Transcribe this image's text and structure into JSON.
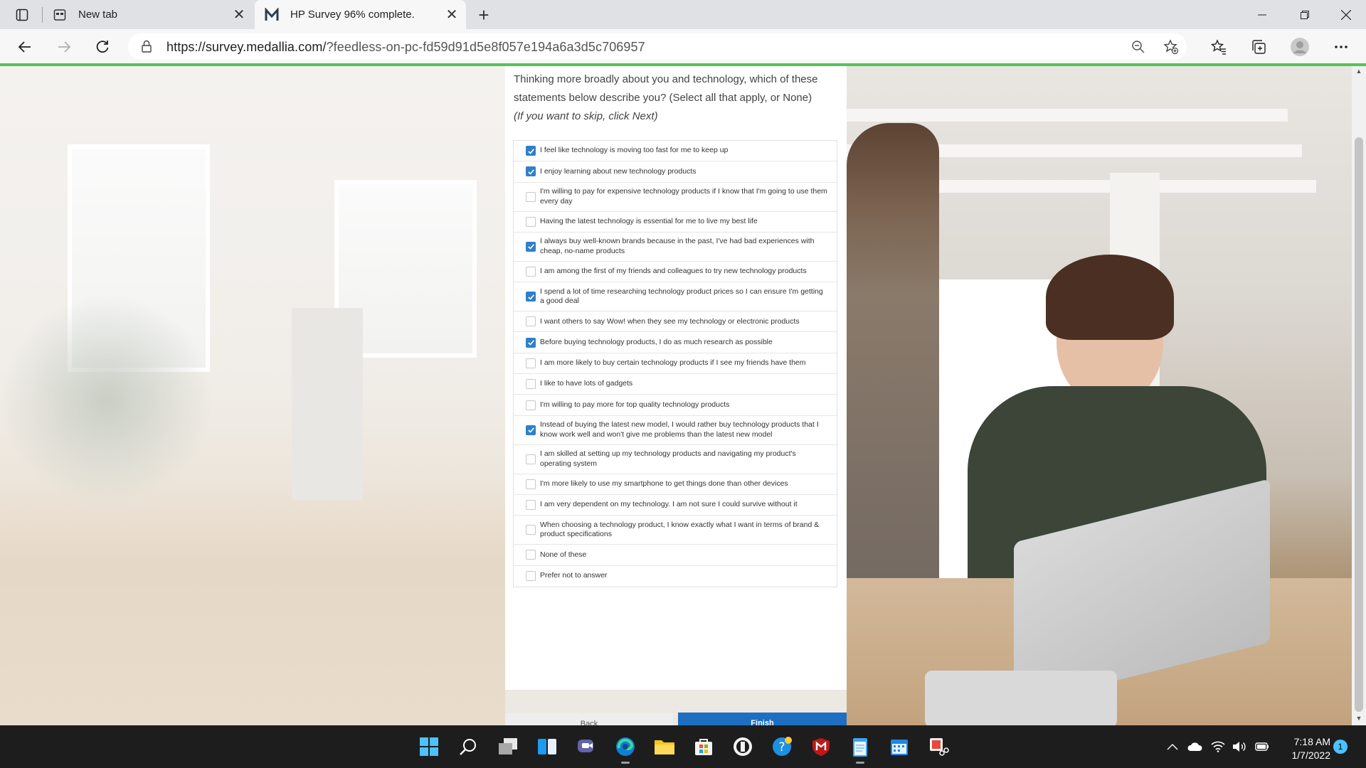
{
  "browser": {
    "tabs": [
      {
        "title": "New tab",
        "active": false,
        "icon": "new-tab-page-icon"
      },
      {
        "title": "HP Survey 96% complete.",
        "active": true,
        "icon": "medallia-m-icon"
      }
    ],
    "url_host": "https://survey.medallia.com/",
    "url_rest": "?feedless-on-pc-fd59d91d5e8f057e194a6a3d5c706957",
    "page_load_progress": 1.0,
    "accent_color": "#58c05a"
  },
  "survey": {
    "question": "Thinking more broadly about you and technology, which of these statements below describe you? (Select all that apply, or None)",
    "note": "(If you want to skip, click Next)",
    "options": [
      {
        "label": "I feel like technology is moving too fast for me to keep up",
        "checked": true
      },
      {
        "label": "I enjoy learning about new technology products",
        "checked": true
      },
      {
        "label": "I'm willing to pay for expensive technology products if I know that I'm going to use them every day",
        "checked": false
      },
      {
        "label": "Having the latest technology is essential for me to live my best life",
        "checked": false
      },
      {
        "label": "I always buy well-known brands because in the past, I've had bad experiences with cheap, no-name products",
        "checked": true
      },
      {
        "label": "I am among the first of my friends and colleagues to try new technology products",
        "checked": false
      },
      {
        "label": "I spend a lot of time researching technology product prices so I can ensure I'm getting a good deal",
        "checked": true
      },
      {
        "label": "I want others to say Wow! when they see my technology or electronic products",
        "checked": false
      },
      {
        "label": "Before buying technology products, I do as much research as possible",
        "checked": true
      },
      {
        "label": "I am more likely to buy certain technology products if I see my friends have them",
        "checked": false
      },
      {
        "label": "I like to have lots of gadgets",
        "checked": false
      },
      {
        "label": "I'm willing to pay more for top quality technology products",
        "checked": false
      },
      {
        "label": "Instead of buying the latest new model, I would rather buy technology products that I know work well and won't give me problems than the latest new model",
        "checked": true
      },
      {
        "label": "I am skilled at setting up my technology products and navigating my product's operating system",
        "checked": false
      },
      {
        "label": "I'm more likely to use my smartphone to get things done than other devices",
        "checked": false
      },
      {
        "label": "I am very dependent on my technology. I am not sure I could survive without it",
        "checked": false
      },
      {
        "label": "When choosing a technology product, I know exactly what I want in terms of brand & product specifications",
        "checked": false
      },
      {
        "label": "None of these",
        "checked": false
      },
      {
        "label": "Prefer not to answer",
        "checked": false
      }
    ],
    "back_label": "Back",
    "finish_label": "Finish",
    "checkbox_color": "#2f7fcb",
    "finish_color": "#1e6fc2"
  },
  "taskbar": {
    "time": "7:18 AM",
    "date": "1/7/2022",
    "notification_count": "1",
    "apps": [
      "start-icon",
      "search-icon",
      "task-view-icon",
      "widgets-icon",
      "teams-chat-icon",
      "edge-icon",
      "file-explorer-icon",
      "microsoft-store-icon",
      "app-circle-icon",
      "help-icon",
      "mcafee-icon",
      "notepad-icon",
      "calendar-icon",
      "snipping-tool-icon"
    ]
  }
}
